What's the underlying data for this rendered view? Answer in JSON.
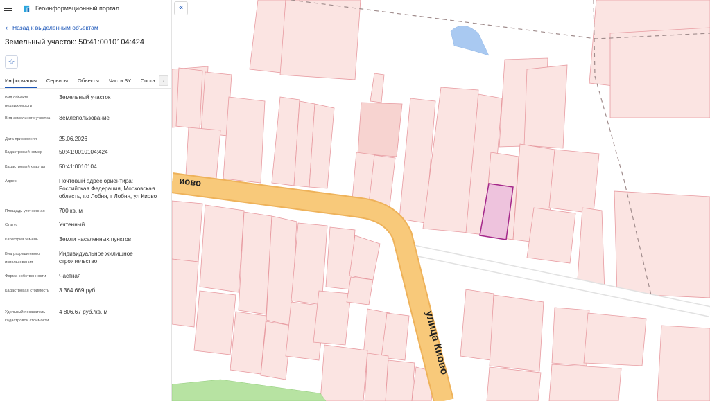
{
  "app": {
    "title": "Геоинформационный портал"
  },
  "nav": {
    "back_label": "Назад к выделенным объектам"
  },
  "object": {
    "title": "Земельный участок: 50:41:0010104:424"
  },
  "tabs": [
    "Информация",
    "Сервисы",
    "Объекты",
    "Части ЗУ",
    "Соста"
  ],
  "active_tab": "Информация",
  "properties": [
    {
      "label": "Вид объекта недвижимости",
      "value": "Земельный участок"
    },
    {
      "label": "Вид земельного участка",
      "value": "Землепользование"
    },
    {
      "label": "Дата присвоения",
      "value": "25.06.2026"
    },
    {
      "label": "Кадастровый номер",
      "value": "50:41:0010104:424"
    },
    {
      "label": "Кадастровый квартал",
      "value": "50:41:0010104"
    },
    {
      "label": "Адрес",
      "value": "Почтовый адрес ориентира: Российская Федерация, Московская область, г.о Лобня, г Лобня, ул Киово"
    },
    {
      "label": "Площадь уточненная",
      "value": "700 кв. м"
    },
    {
      "label": "Статус",
      "value": "Учтенный"
    },
    {
      "label": "Категория земель",
      "value": "Земли населенных пунктов"
    },
    {
      "label": "Вид разрешенного использования",
      "value": "Индивидуальное жилищное строительство"
    },
    {
      "label": "Форма собственности",
      "value": "Частная"
    },
    {
      "label": "Кадастровая стоимость",
      "value": "3 364 669 руб."
    },
    {
      "label": "Удельный показатель кадастровой стоимости",
      "value": "4 806,67 руб./кв. м"
    }
  ],
  "map": {
    "street_label_top": "иово",
    "street_label_diag": "улица Киово",
    "colors": {
      "parcel_fill": "#fbe4e2",
      "parcel_stroke": "#e79aa0",
      "road": "#f8c97a",
      "road_edge": "#eeb25a",
      "selected_fill": "#eec3dd",
      "selected_stroke": "#a4278a",
      "water": "#a9c9f1",
      "green": "#b7e3a2",
      "accent": "#1a55b8"
    }
  },
  "icons": {
    "menu": "hamburger-icon",
    "logo": "portal-logo-icon",
    "back": "chevron-left-icon",
    "star": "star-icon",
    "tabs_more": "chevron-right-icon",
    "collapse": "double-chevron-left-icon"
  }
}
